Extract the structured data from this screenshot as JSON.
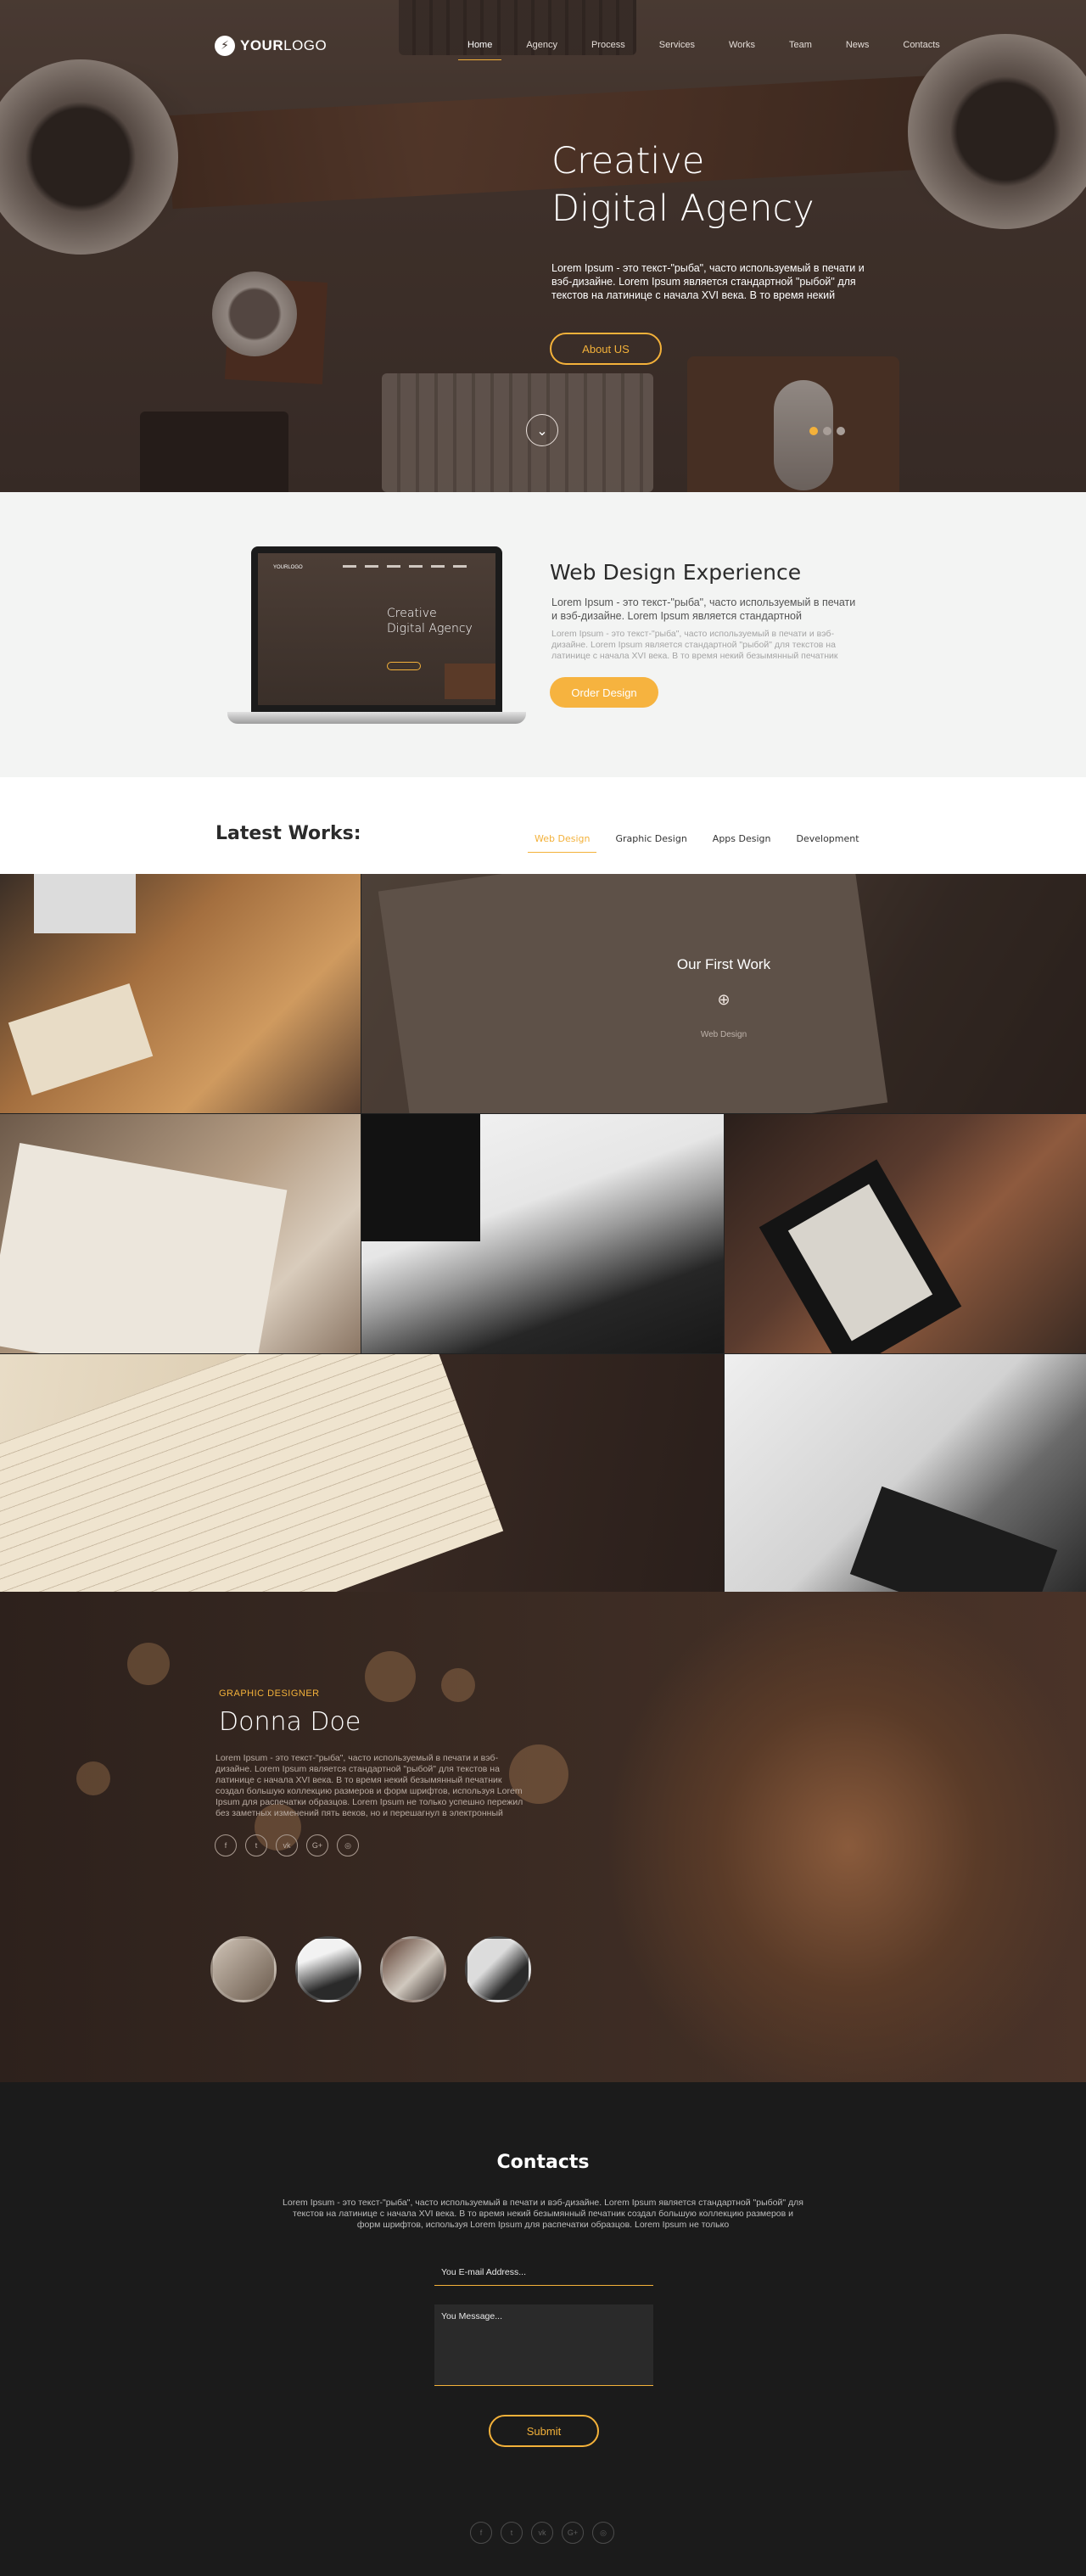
{
  "brand": {
    "logo_mark": "⚡",
    "logo_bold": "YOUR",
    "logo_light": "LOGO"
  },
  "nav": {
    "items": [
      {
        "label": "Home",
        "active": true
      },
      {
        "label": "Agency"
      },
      {
        "label": "Process"
      },
      {
        "label": "Services"
      },
      {
        "label": "Works"
      },
      {
        "label": "Team"
      },
      {
        "label": "News"
      },
      {
        "label": "Contacts"
      }
    ]
  },
  "hero": {
    "title_line1": "Creative",
    "title_line2": "Digital Agency",
    "text": "Lorem Ipsum - это текст-\"рыба\", часто используемый в печати и вэб-дизайне. Lorem Ipsum является стандартной \"рыбой\" для текстов на латинице с начала XVI века. В то время некий",
    "button": "About US",
    "scroll_icon": "chevron-down-icon",
    "slider": {
      "count": 3,
      "active_index": 0
    }
  },
  "experience": {
    "title": "Web Design Experience",
    "lead": "Lorem Ipsum - это текст-\"рыба\", часто используемый в печати и вэб-дизайне. Lorem Ipsum является стандартной",
    "body": "Lorem Ipsum - это текст-\"рыба\", часто используемый в печати и вэб-дизайне. Lorem Ipsum является стандартной \"рыбой\" для текстов на латинице с начала XVI века. В то время некий безымянный печатник",
    "button": "Order Design",
    "laptop_screen": {
      "logo": "YOURLOGO",
      "title_line1": "Creative",
      "title_line2": "Digital Agency"
    }
  },
  "works": {
    "title": "Latest Works:",
    "tabs": [
      {
        "label": "Web Design",
        "active": true
      },
      {
        "label": "Graphic Design"
      },
      {
        "label": "Apps Design"
      },
      {
        "label": "Development"
      }
    ],
    "featured": {
      "title": "Our First Work",
      "category": "Web Design",
      "icon": "zoom-in-icon"
    }
  },
  "team": {
    "role": "GRAPHIC DESIGNER",
    "name": "Donna Doe",
    "bio": "Lorem Ipsum - это текст-\"рыба\", часто используемый в печати и вэб-дизайне. Lorem Ipsum является стандартной \"рыбой\" для текстов на латинице с начала XVI века. В то время некий безымянный печатник создал большую коллекцию размеров и форм шрифтов, используя Lorem Ipsum для распечатки образцов. Lorem Ipsum не только успешно пережил без заметных изменений пять веков, но и перешагнул в электронный",
    "social": [
      "f",
      "t",
      "vk",
      "G+",
      "◎"
    ],
    "thumbs_active_index": 0
  },
  "contacts": {
    "title": "Contacts",
    "text": "Lorem Ipsum - это текст-\"рыба\", часто используемый в печати и вэб-дизайне. Lorem Ipsum является стандартной \"рыбой\" для текстов на латинице с начала XVI века. В то время некий безымянный печатник создал большую коллекцию размеров и форм шрифтов, используя Lorem Ipsum для распечатки образцов. Lorem Ipsum не только",
    "email_placeholder": "You E-mail Address...",
    "message_placeholder": "You Message...",
    "submit": "Submit",
    "social": [
      "f",
      "t",
      "vk",
      "G+",
      "◎"
    ]
  },
  "colors": {
    "accent": "#f3b13a",
    "dark": "#1b1b1b",
    "light_bg": "#f3f4f3"
  }
}
